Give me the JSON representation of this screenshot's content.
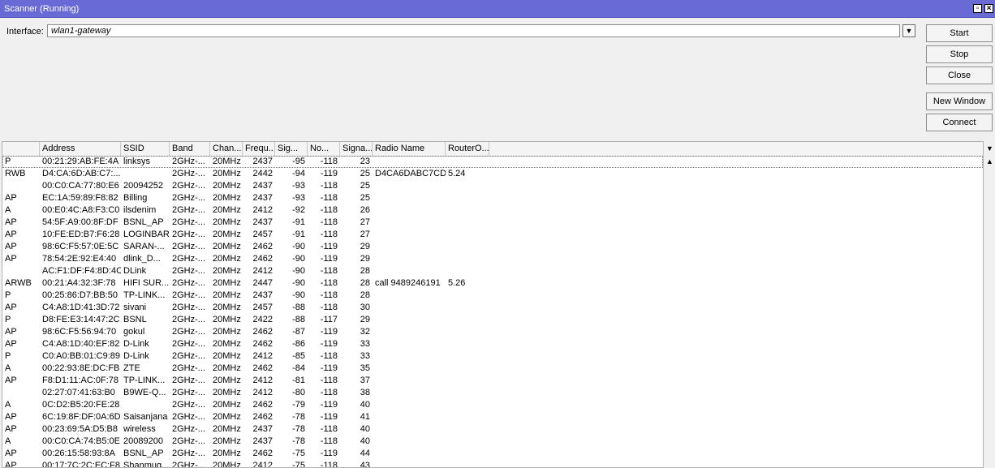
{
  "window": {
    "title": "Scanner (Running)",
    "restore_icon": "restore-icon",
    "close_icon": "close-icon"
  },
  "interface": {
    "label": "Interface:",
    "value": "wlan1-gateway",
    "dropdown_icon": "dropdown-arrow-icon"
  },
  "buttons": {
    "start": "Start",
    "stop": "Stop",
    "close": "Close",
    "new_window": "New Window",
    "connect": "Connect"
  },
  "table": {
    "columns": [
      "",
      "Address",
      "SSID",
      "Band",
      "Chan...",
      "Frequ...",
      "Sig...",
      "No...",
      "Signa...",
      "Radio Name",
      "RouterO..."
    ],
    "rows": [
      [
        "P",
        "00:21:29:AB:FE:4A",
        "linksys",
        "2GHz-...",
        "20MHz",
        "2437",
        "-95",
        "-118",
        "23",
        "",
        ""
      ],
      [
        "RWB",
        "D4:CA:6D:AB:C7:...",
        "",
        "2GHz-...",
        "20MHz",
        "2442",
        "-94",
        "-119",
        "25",
        "D4CA6DABC7CD",
        "5.24"
      ],
      [
        "",
        "00:C0:CA:77:80:E6",
        "20094252",
        "2GHz-...",
        "20MHz",
        "2437",
        "-93",
        "-118",
        "25",
        "",
        ""
      ],
      [
        "AP",
        "EC:1A:59:89:F8:82",
        "Billing",
        "2GHz-...",
        "20MHz",
        "2437",
        "-93",
        "-118",
        "25",
        "",
        ""
      ],
      [
        "A",
        "00:E0:4C:A8:F3:C0",
        "ilsdenim",
        "2GHz-...",
        "20MHz",
        "2412",
        "-92",
        "-118",
        "26",
        "",
        ""
      ],
      [
        "AP",
        "54:5F:A9:00:8F:DF",
        "BSNL_AP",
        "2GHz-...",
        "20MHz",
        "2437",
        "-91",
        "-118",
        "27",
        "",
        ""
      ],
      [
        "AP",
        "10:FE:ED:B7:F6:28",
        "LOGINBAR",
        "2GHz-...",
        "20MHz",
        "2457",
        "-91",
        "-118",
        "27",
        "",
        ""
      ],
      [
        "AP",
        "98:6C:F5:57:0E:5C",
        "SARAN-...",
        "2GHz-...",
        "20MHz",
        "2462",
        "-90",
        "-119",
        "29",
        "",
        ""
      ],
      [
        "AP",
        "78:54:2E:92:E4:40",
        "dlink_D...",
        "2GHz-...",
        "20MHz",
        "2462",
        "-90",
        "-119",
        "29",
        "",
        ""
      ],
      [
        "",
        "AC:F1:DF:F4:8D:4C",
        "DLink",
        "2GHz-...",
        "20MHz",
        "2412",
        "-90",
        "-118",
        "28",
        "",
        ""
      ],
      [
        "ARWB",
        "00:21:A4:32:3F:78",
        "HIFI SUR...",
        "2GHz-...",
        "20MHz",
        "2447",
        "-90",
        "-118",
        "28",
        "call 9489246191",
        "5.26"
      ],
      [
        "P",
        "00:25:86:D7:BB:50",
        "TP-LINK...",
        "2GHz-...",
        "20MHz",
        "2437",
        "-90",
        "-118",
        "28",
        "",
        ""
      ],
      [
        "AP",
        "C4:A8:1D:41:3D:72",
        "sivani",
        "2GHz-...",
        "20MHz",
        "2457",
        "-88",
        "-118",
        "30",
        "",
        ""
      ],
      [
        "P",
        "D8:FE:E3:14:47:2C",
        "BSNL",
        "2GHz-...",
        "20MHz",
        "2422",
        "-88",
        "-117",
        "29",
        "",
        ""
      ],
      [
        "AP",
        "98:6C:F5:56:94:70",
        "gokul",
        "2GHz-...",
        "20MHz",
        "2462",
        "-87",
        "-119",
        "32",
        "",
        ""
      ],
      [
        "AP",
        "C4:A8:1D:40:EF:82",
        "D-Link",
        "2GHz-...",
        "20MHz",
        "2462",
        "-86",
        "-119",
        "33",
        "",
        ""
      ],
      [
        "P",
        "C0:A0:BB:01:C9:89",
        "D-Link",
        "2GHz-...",
        "20MHz",
        "2412",
        "-85",
        "-118",
        "33",
        "",
        ""
      ],
      [
        "A",
        "00:22:93:8E:DC:FB",
        "ZTE",
        "2GHz-...",
        "20MHz",
        "2462",
        "-84",
        "-119",
        "35",
        "",
        ""
      ],
      [
        "AP",
        "F8:D1:11:AC:0F:78",
        "TP-LINK...",
        "2GHz-...",
        "20MHz",
        "2412",
        "-81",
        "-118",
        "37",
        "",
        ""
      ],
      [
        "",
        "02:27:07:41:63:B0",
        "B9WE-Q...",
        "2GHz-...",
        "20MHz",
        "2412",
        "-80",
        "-118",
        "38",
        "",
        ""
      ],
      [
        "A",
        "0C:D2:B5:20:FE:28",
        "",
        "2GHz-...",
        "20MHz",
        "2462",
        "-79",
        "-119",
        "40",
        "",
        ""
      ],
      [
        "AP",
        "6C:19:8F:DF:0A:6D",
        "Saisanjana",
        "2GHz-...",
        "20MHz",
        "2462",
        "-78",
        "-119",
        "41",
        "",
        ""
      ],
      [
        "AP",
        "00:23:69:5A:D5:B8",
        "wireless",
        "2GHz-...",
        "20MHz",
        "2437",
        "-78",
        "-118",
        "40",
        "",
        ""
      ],
      [
        "A",
        "00:C0:CA:74:B5:0E",
        "20089200",
        "2GHz-...",
        "20MHz",
        "2437",
        "-78",
        "-118",
        "40",
        "",
        ""
      ],
      [
        "AP",
        "00:26:15:58:93:8A",
        "BSNL_AP",
        "2GHz-...",
        "20MHz",
        "2462",
        "-75",
        "-119",
        "44",
        "",
        ""
      ],
      [
        "AP",
        "00:17:7C:2C:EC:F8",
        "Shanmug...",
        "2GHz-...",
        "20MHz",
        "2412",
        "-75",
        "-118",
        "43",
        "",
        ""
      ]
    ]
  }
}
